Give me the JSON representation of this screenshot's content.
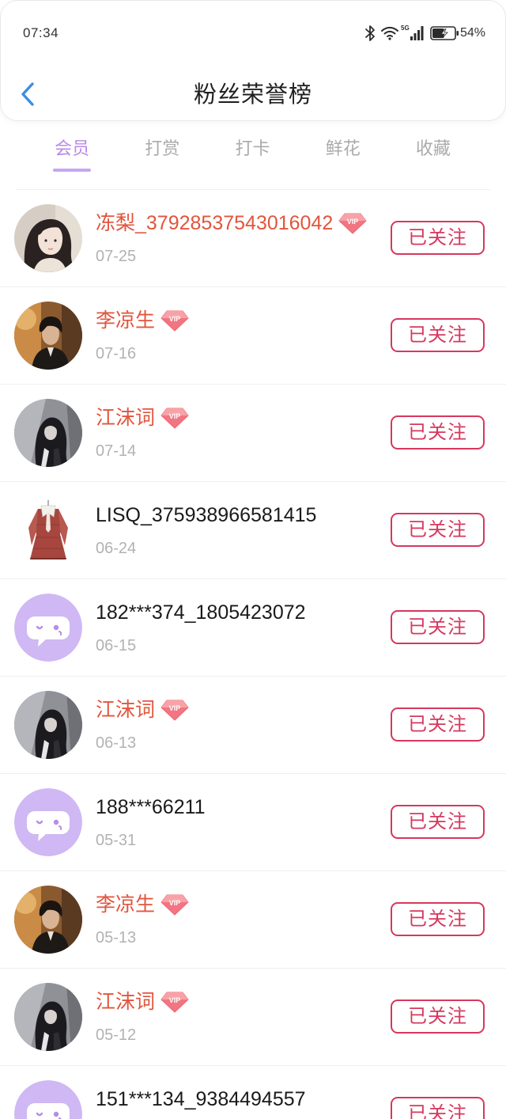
{
  "status_bar": {
    "time": "07:34",
    "network_type": "5G",
    "battery_percent": "54%",
    "icons": [
      "bluetooth-icon",
      "wifi-icon",
      "signal-icon",
      "battery-icon"
    ]
  },
  "header": {
    "back_icon": "chevron-left-icon",
    "title": "粉丝荣誉榜"
  },
  "tabs": [
    {
      "label": "会员",
      "active": true
    },
    {
      "label": "打赏",
      "active": false
    },
    {
      "label": "打卡",
      "active": false
    },
    {
      "label": "鲜花",
      "active": false
    },
    {
      "label": "收藏",
      "active": false
    }
  ],
  "vip_badge_label": "VIP",
  "colors": {
    "accent_purple": "#b88ae6",
    "tab_indicator": "#c6a6f2",
    "back_blue": "#3a8ee6",
    "vip_name": "#e2553d",
    "follow_button": "#d6385d",
    "default_avatar_bg": "#cfb8f4"
  },
  "fans": [
    {
      "name": "冻梨_37928537543016042",
      "vip": true,
      "date": "07-25",
      "avatar": "user-photo-1",
      "follow_label": "已关注"
    },
    {
      "name": "李凉生",
      "vip": true,
      "date": "07-16",
      "avatar": "user-photo-2",
      "follow_label": "已关注"
    },
    {
      "name": "江沫词",
      "vip": true,
      "date": "07-14",
      "avatar": "user-photo-3",
      "follow_label": "已关注"
    },
    {
      "name": "LISQ_375938966581415",
      "vip": false,
      "date": "06-24",
      "avatar": "user-photo-4",
      "follow_label": "已关注"
    },
    {
      "name": "182***374_1805423072",
      "vip": false,
      "date": "06-15",
      "avatar": "default-avatar-icon",
      "follow_label": "已关注"
    },
    {
      "name": "江沫词",
      "vip": true,
      "date": "06-13",
      "avatar": "user-photo-3",
      "follow_label": "已关注"
    },
    {
      "name": "188***66211",
      "vip": false,
      "date": "05-31",
      "avatar": "default-avatar-icon",
      "follow_label": "已关注"
    },
    {
      "name": "李凉生",
      "vip": true,
      "date": "05-13",
      "avatar": "user-photo-2",
      "follow_label": "已关注"
    },
    {
      "name": "江沫词",
      "vip": true,
      "date": "05-12",
      "avatar": "user-photo-3",
      "follow_label": "已关注"
    },
    {
      "name": "151***134_9384494557",
      "vip": false,
      "avatar": "default-avatar-icon",
      "follow_label": "已关注"
    }
  ]
}
